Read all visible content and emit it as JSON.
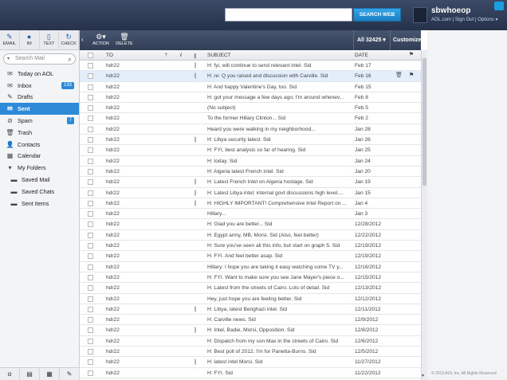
{
  "header": {
    "search_placeholder": "",
    "search_button": "SEARCH WEB",
    "username": "sbwhoeop",
    "user_links": "AOL.com | Sign Out | Options ▾"
  },
  "quickbar": [
    {
      "label": "EMAIL",
      "icon": "✎",
      "name": "email-button"
    },
    {
      "label": "IM",
      "icon": "●",
      "name": "im-button"
    },
    {
      "label": "TEXT",
      "icon": "▯",
      "name": "text-button"
    },
    {
      "label": "CHECK",
      "icon": "↻",
      "name": "check-button"
    }
  ],
  "search_mail": {
    "placeholder": "Search Mail"
  },
  "folders": [
    {
      "label": "Today on AOL",
      "icon": "✉",
      "badge": ""
    },
    {
      "label": "Inbox",
      "icon": "✉",
      "badge": "133"
    },
    {
      "label": "Drafts",
      "icon": "✎",
      "badge": ""
    },
    {
      "label": "Sent",
      "icon": "✉",
      "badge": "",
      "active": true
    },
    {
      "label": "Spam",
      "icon": "⊘",
      "badge": "7"
    },
    {
      "label": "Trash",
      "icon": "🗑",
      "badge": ""
    },
    {
      "label": "Contacts",
      "icon": "👤",
      "badge": ""
    },
    {
      "label": "Calendar",
      "icon": "▦",
      "badge": ""
    },
    {
      "label": "My Folders",
      "icon": "▾",
      "badge": ""
    },
    {
      "label": "Saved Mail",
      "icon": "▬",
      "badge": "",
      "sub": true
    },
    {
      "label": "Saved Chats",
      "icon": "▬",
      "badge": "",
      "sub": true
    },
    {
      "label": "Sent Items",
      "icon": "▬",
      "badge": "",
      "sub": true
    }
  ],
  "toolbar": {
    "action_label": "ACTION",
    "delete_label": "DELETE",
    "all_count": "All 32425 ▾",
    "customize": "Customize ▾"
  },
  "columns": {
    "to": "TO",
    "subject": "SUBJECT",
    "date": "DATE"
  },
  "messages": [
    {
      "to": "hdr22",
      "clip": true,
      "subject": "H: fyi, will continue to send relevant intel. Sid",
      "date": "Feb 17"
    },
    {
      "to": "hdr22",
      "clip": true,
      "subject": "H: re: Q you raised and discussion with Carville. Sid",
      "date": "Feb 16",
      "selected": true
    },
    {
      "to": "hdr22",
      "clip": false,
      "subject": "H: And happy Valentine's Day, too. Sid",
      "date": "Feb 15"
    },
    {
      "to": "hdr22",
      "clip": false,
      "subject": "H: got your message a few days ago; I'm around whenev...",
      "date": "Feb 8"
    },
    {
      "to": "hdr22",
      "clip": false,
      "subject": "(No subject)",
      "date": "Feb 5"
    },
    {
      "to": "hdr22",
      "clip": false,
      "subject": "To the former Hillary Clinton... Sid",
      "date": "Feb 2"
    },
    {
      "to": "hdr22",
      "clip": false,
      "subject": "Heard you were walking in my neighborhood...",
      "date": "Jan 28"
    },
    {
      "to": "hdr22",
      "clip": true,
      "subject": "H: Libya security latest. Sid",
      "date": "Jan 26"
    },
    {
      "to": "hdr22",
      "clip": false,
      "subject": "H: FYI, best analysis so far of hearing. Sid",
      "date": "Jan 25"
    },
    {
      "to": "hdr22",
      "clip": false,
      "subject": "H: today. Sid",
      "date": "Jan 24"
    },
    {
      "to": "hdr22",
      "clip": false,
      "subject": "H: Algeria latest French intel. Sid",
      "date": "Jan 20"
    },
    {
      "to": "hdr22",
      "clip": true,
      "subject": "H: Latest French Intel on Algeria hostage. Sid",
      "date": "Jan 19"
    },
    {
      "to": "hdr22",
      "clip": true,
      "subject": "H: Latest Libya intel; internal govt discussions high level....",
      "date": "Jan 15"
    },
    {
      "to": "hdr22",
      "clip": true,
      "subject": "H: HIGHLY IMPORTANT! Comprehensive Intel Report on ...",
      "date": "Jan 4"
    },
    {
      "to": "hdr22",
      "clip": false,
      "subject": "Hillary...",
      "date": "Jan 3"
    },
    {
      "to": "hdr22",
      "clip": false,
      "subject": "H: Glad you are better... Sid",
      "date": "12/28/2012"
    },
    {
      "to": "hdr22",
      "clip": false,
      "subject": "H: Egypt army, MB, Morsi. Sid (Also, feel better)",
      "date": "12/22/2012"
    },
    {
      "to": "hdr22",
      "clip": false,
      "subject": "H: Sure you've seen all this info, but start on graph 5. Sid",
      "date": "12/19/2012"
    },
    {
      "to": "hdr22",
      "clip": false,
      "subject": "H: FYI. And feel better asap. Sid",
      "date": "12/19/2012"
    },
    {
      "to": "hdr22",
      "clip": false,
      "subject": "Hillary: I hope you are taking it easy watching some TV y...",
      "date": "12/16/2012"
    },
    {
      "to": "hdr22",
      "clip": false,
      "subject": "H: FYI. Want to make sure you see Jane Mayer's piece o...",
      "date": "12/15/2012"
    },
    {
      "to": "hdr22",
      "clip": false,
      "subject": "H: Latest from the streets of Cairo. Lots of detail. Sid",
      "date": "12/13/2012"
    },
    {
      "to": "hdr22",
      "clip": false,
      "subject": "Hey, just hope you are feeling better. Sid",
      "date": "12/12/2012"
    },
    {
      "to": "hdr22",
      "clip": true,
      "subject": "H: Libya, latest Benghazi intel. Sid",
      "date": "12/11/2012"
    },
    {
      "to": "hdr22",
      "clip": false,
      "subject": "H: Carville news. Sid",
      "date": "12/9/2012"
    },
    {
      "to": "hdr22",
      "clip": true,
      "subject": "H: Intel, Badie, Morsi, Opposition. Sid",
      "date": "12/8/2012"
    },
    {
      "to": "hdr22",
      "clip": false,
      "subject": "H: Dispatch from my son Max in the streets of Cairo. Sid",
      "date": "12/6/2012"
    },
    {
      "to": "hdr22",
      "clip": false,
      "subject": "H: Best poll of 2012. I'm for Panetta-Burns. Sid",
      "date": "12/5/2012"
    },
    {
      "to": "hdr22",
      "clip": true,
      "subject": "H: latest intel Morsi. Sid",
      "date": "11/27/2012"
    },
    {
      "to": "hdr22",
      "clip": false,
      "subject": "H: FYI. Sid",
      "date": "11/22/2012"
    }
  ],
  "copyright": "© 2013 AOL Inc. All Rights Reserved"
}
